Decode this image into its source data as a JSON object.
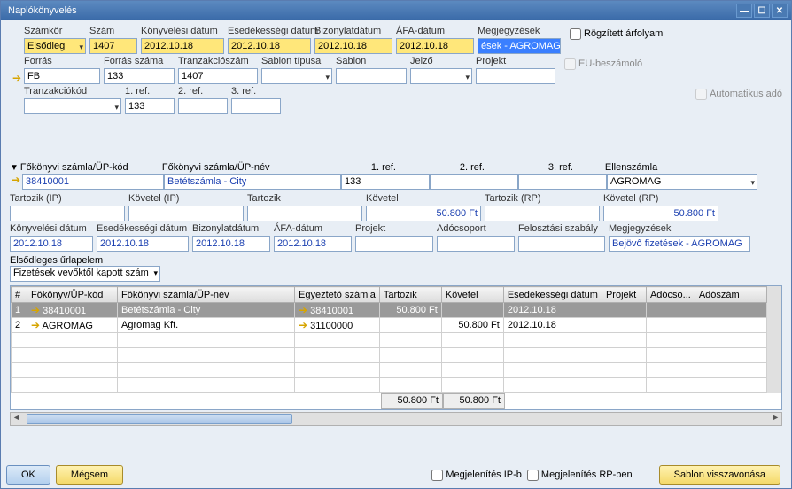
{
  "window_title": "Naplókönyvelés",
  "header": {
    "szamkor_lbl": "Számkör",
    "szamkor": "Elsődleg",
    "szam_lbl": "Szám",
    "szam": "1407",
    "konyv_lbl": "Könyvelési dátum",
    "konyv": "2012.10.18",
    "esed_lbl": "Esedékességi dátum",
    "esed": "2012.10.18",
    "biz_lbl": "Bizonylatdátum",
    "biz": "2012.10.18",
    "afa_lbl": "ÁFA-dátum",
    "afa": "2012.10.18",
    "megj_lbl": "Megjegyzések",
    "megj_vis": "ések - AGROMAG",
    "rogz_lbl": "Rögzített árfolyam"
  },
  "r2": {
    "forras_lbl": "Forrás",
    "forras": "FB",
    "forrsz_lbl": "Forrás száma",
    "forrsz": "133",
    "transz_lbl": "Tranzakciószám",
    "transz": "1407",
    "sabltip_lbl": "Sablon típusa",
    "sablon_lbl": "Sablon",
    "jelzo_lbl": "Jelző",
    "projekt_lbl": "Projekt",
    "eub_lbl": "EU-beszámoló"
  },
  "r3": {
    "tkod_lbl": "Tranzakciókód",
    "ref1_lbl": "1. ref.",
    "ref1": "133",
    "ref2_lbl": "2. ref.",
    "ref3_lbl": "3. ref.",
    "auto_lbl": "Automatikus adó"
  },
  "acc": {
    "heading": "Főkönyvi számla/ÜP-kód",
    "fkszup_name_lbl": "Főkönyvi számla/ÜP-név",
    "ref1_lbl": "1. ref.",
    "ref2_lbl": "2. ref.",
    "ref3_lbl": "3. ref.",
    "ellen_lbl": "Ellenszámla",
    "fk_kod": "38410001",
    "fk_nev": "Betétszámla - City",
    "ref1": "133",
    "ellen": "AGROMAG"
  },
  "amt": {
    "tartozik_ip_lbl": "Tartozik (IP)",
    "kovetel_ip_lbl": "Követel (IP)",
    "tartozik_lbl": "Tartozik",
    "kovetel_lbl": "Követel",
    "tartozik_rp_lbl": "Tartozik (RP)",
    "kovetel_rp_lbl": "Követel (RP)",
    "kov": "50.800 Ft",
    "kov_rp": "50.800 Ft"
  },
  "dat2": {
    "konyv_lbl": "Könyvelési dátum",
    "konyv": "2012.10.18",
    "esed_lbl": "Esedékességi dátum",
    "esed": "2012.10.18",
    "biz_lbl": "Bizonylatdátum",
    "biz": "2012.10.18",
    "afa_lbl": "ÁFA-dátum",
    "afa": "2012.10.18",
    "projekt_lbl": "Projekt",
    "ado_lbl": "Adócsoport",
    "felo_lbl": "Felosztási szabály",
    "megj_lbl": "Megjegyzések",
    "megj": "Bejövő fizetések - AGROMAG"
  },
  "primary_form": {
    "lbl": "Elsődleges űrlapelem",
    "val": "Fizetések vevőktől kapott szám"
  },
  "grid": {
    "cols": {
      "num": "#",
      "fk": "Főkönyv/ÜP-kód",
      "fn": "Főkönyvi számla/ÜP-név",
      "egy": "Egyeztető számla",
      "tar": "Tartozik",
      "kov": "Követel",
      "esed": "Esedékességi dátum",
      "proj": "Projekt",
      "ado": "Adócso...",
      "adosz": "Adószám"
    },
    "rows": [
      {
        "n": "1",
        "fk": "38410001",
        "fn": "Betétszámla - City",
        "egy": "38410001",
        "tar": "50.800 Ft",
        "kov": "",
        "esed": "2012.10.18"
      },
      {
        "n": "2",
        "fk": "AGROMAG",
        "fn": "Agromag Kft.",
        "egy": "31100000",
        "tar": "",
        "kov": "50.800 Ft",
        "esed": "2012.10.18"
      }
    ],
    "sum_tar": "50.800 Ft",
    "sum_kov": "50.800 Ft"
  },
  "footer": {
    "ok": "OK",
    "cancel": "Mégsem",
    "megj_ip": "Megjelenítés IP-b",
    "megj_rp": "Megjelenítés RP-ben",
    "sablon": "Sablon visszavonása"
  }
}
